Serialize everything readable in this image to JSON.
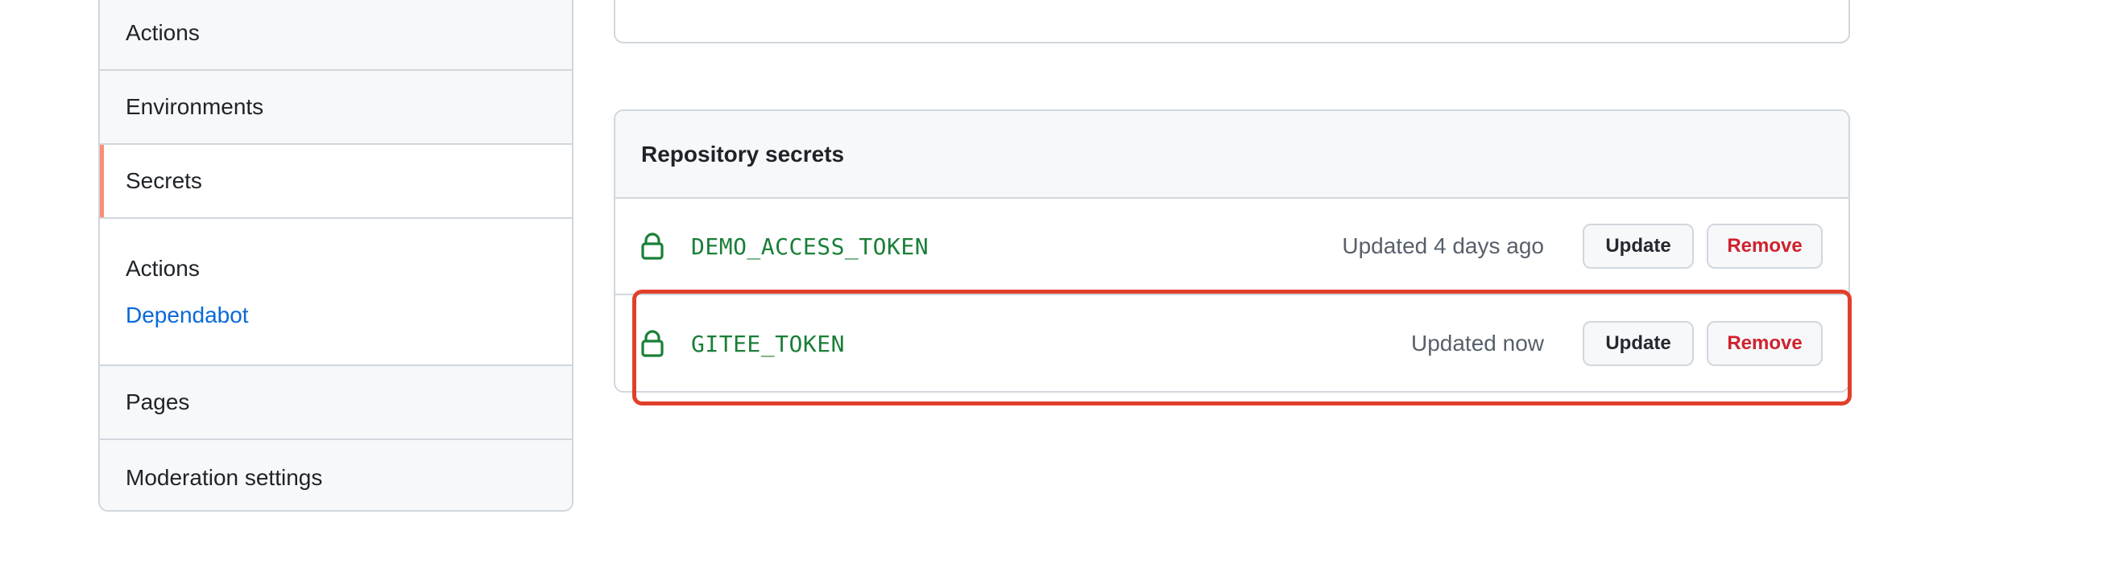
{
  "sidebar": {
    "items_top": [
      {
        "label": "Actions"
      },
      {
        "label": "Environments"
      },
      {
        "label": "Secrets",
        "selected": true
      }
    ],
    "secrets_sub": {
      "heading": "Actions",
      "link": "Dependabot"
    },
    "items_bottom": [
      {
        "label": "Pages"
      },
      {
        "label": "Moderation settings"
      }
    ]
  },
  "secrets": {
    "header": "Repository secrets",
    "rows": [
      {
        "name": "DEMO_ACCESS_TOKEN",
        "updated": "Updated 4 days ago",
        "update_label": "Update",
        "remove_label": "Remove"
      },
      {
        "name": "GITEE_TOKEN",
        "updated": "Updated now",
        "update_label": "Update",
        "remove_label": "Remove"
      }
    ]
  },
  "colors": {
    "accent_selected": "#fd8c73",
    "secret_name": "#1a7f37",
    "link": "#0969da",
    "danger": "#cf222e",
    "highlight": "#e0402a"
  },
  "icons": {
    "secret_lock": "lock-icon"
  }
}
